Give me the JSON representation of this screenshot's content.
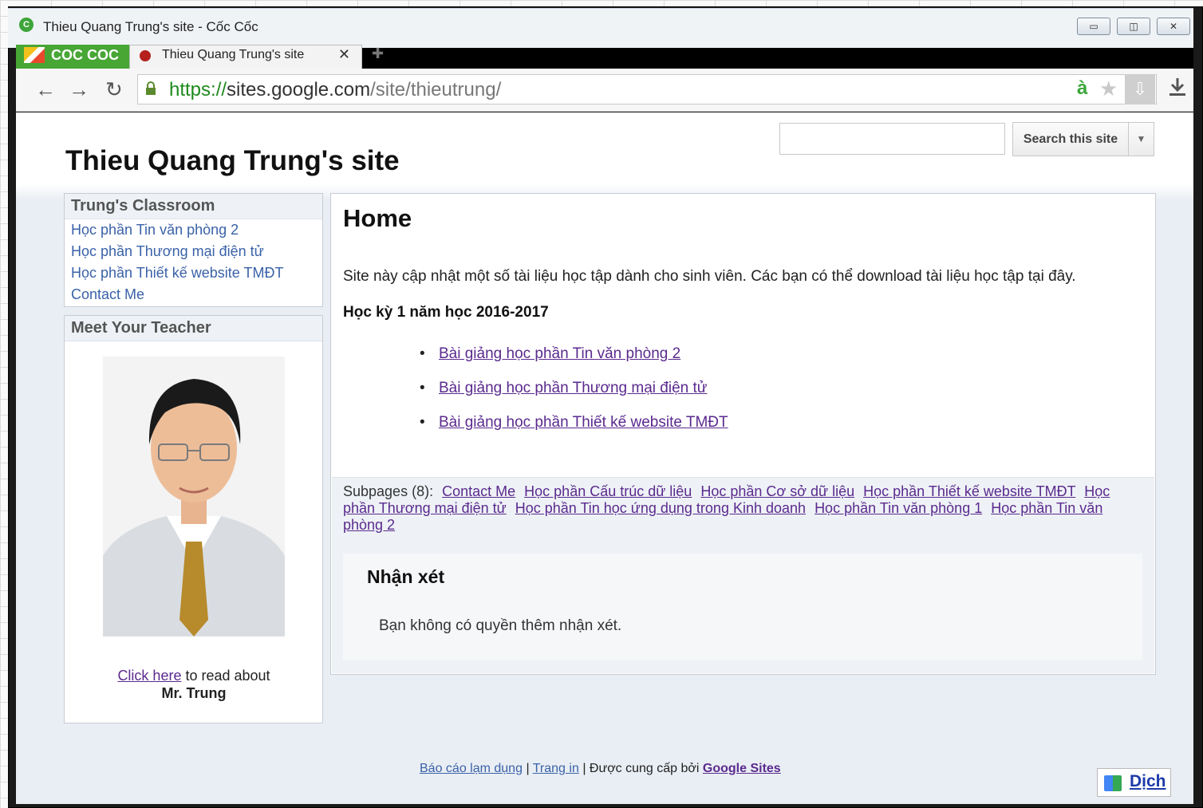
{
  "window": {
    "title": "Thieu Quang Trung's site - Cốc Cốc",
    "minimize": "▭",
    "maximize": "◫",
    "close": "✕"
  },
  "browser": {
    "brand": "COC COC",
    "tab_title": "Thieu Quang Trung's site",
    "tab_close": "✕",
    "new_tab": "✚",
    "url_scheme": "https://",
    "url_host": "sites.google.com",
    "url_path": "/site/thieutrung/",
    "omni_badge": "à",
    "back": "←",
    "forward": "→",
    "reload": "↻",
    "lock": "🔒",
    "star": "★",
    "download": "⇩"
  },
  "site": {
    "title": "Thieu Quang Trung's site",
    "search_button": "Search this site",
    "search_placeholder": ""
  },
  "sidebar": {
    "classroom_heading": "Trung's Classroom",
    "classroom_links": [
      "Học phần Tin văn phòng 2",
      "Học phần Thương mại điện tử",
      "Học phần Thiết kế website TMĐT",
      "Contact Me"
    ],
    "teacher_heading": "Meet Your Teacher",
    "caption_link": "Click here",
    "caption_rest": " to read about",
    "caption_name": "Mr. Trung"
  },
  "main": {
    "heading": "Home",
    "intro": "Site này cập nhật một số tài liệu học tập dành cho sinh viên. Các bạn có thể download tài liệu học tập tại đây.",
    "semester": "Học kỳ 1 năm học 2016-2017",
    "lectures": [
      "Bài giảng học phần Tin văn phòng 2",
      "Bài giảng học phần Thương mại điện tử",
      "Bài giảng học phần Thiết kế website TMĐT"
    ],
    "subpages_label": "Subpages (8):",
    "subpages": [
      "Contact Me",
      "Học phần Cấu trúc dữ liệu",
      "Học phần Cơ sở dữ liệu",
      "Học phần Thiết kế website TMĐT",
      "Học phần Thương mại điện tử",
      "Học phần Tin học ứng dụng trong Kinh doanh",
      "Học phần Tin văn phòng 1",
      "Học phần Tin văn phòng 2"
    ],
    "comments_heading": "Nhận xét",
    "comments_note": "Bạn không có quyền thêm nhận xét."
  },
  "footer": {
    "report_abuse": "Báo cáo lạm dụng",
    "print_page": "Trang in",
    "powered_by": "Được cung cấp bởi",
    "google_sites": "Google Sites",
    "sep": "|",
    "translate": "Dịch"
  },
  "colors": {
    "link": "#3a62a8",
    "visited_link": "#5a2a8e",
    "brand_green": "#47a634"
  }
}
